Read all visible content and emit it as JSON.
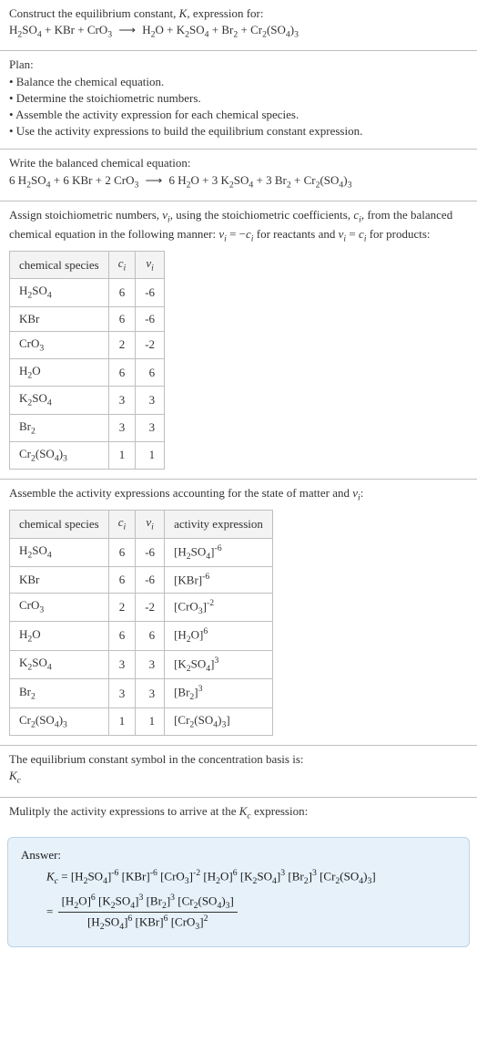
{
  "intro": {
    "line1_pre": "Construct the equilibrium constant, ",
    "line1_K": "K",
    "line1_post": ", expression for:"
  },
  "equation1": {
    "r1": "H",
    "r1s": "2",
    "r1b": "SO",
    "r1bs": "4",
    "plus1": " + ",
    "r2": "KBr",
    "plus2": " + ",
    "r3": "CrO",
    "r3s": "3",
    "arrow": "⟶",
    "p1": "H",
    "p1s": "2",
    "p1b": "O",
    "plus3": " + ",
    "p2": "K",
    "p2s": "2",
    "p2b": "SO",
    "p2bs": "4",
    "plus4": " + ",
    "p3": "Br",
    "p3s": "2",
    "plus5": " + ",
    "p4": "Cr",
    "p4s": "2",
    "p4b": "(SO",
    "p4bs": "4",
    "p4c": ")",
    "p4cs": "3"
  },
  "plan": {
    "title": "Plan:",
    "b1": "• Balance the chemical equation.",
    "b2": "• Determine the stoichiometric numbers.",
    "b3": "• Assemble the activity expression for each chemical species.",
    "b4": "• Use the activity expressions to build the equilibrium constant expression."
  },
  "balanced": {
    "title": "Write the balanced chemical equation:",
    "c1": "6 ",
    "c2": "6 ",
    "c3": "2 ",
    "c4": "6 ",
    "c5": "3 ",
    "c6": "3 "
  },
  "stoich": {
    "intro_a": "Assign stoichiometric numbers, ",
    "intro_b": ", using the stoichiometric coefficients, ",
    "intro_c": ", from the balanced chemical equation in the following manner: ",
    "intro_d": " for reactants and ",
    "intro_e": " for products:",
    "nu": "ν",
    "nui": "i",
    "c": "c",
    "ci": "i",
    "eq1a": "ν",
    "eq1b": " = −",
    "eq1c": "c",
    "eq2a": "ν",
    "eq2b": " = ",
    "eq2c": "c",
    "headers": {
      "h1": "chemical species",
      "h2": "c",
      "h2i": "i",
      "h3": "ν",
      "h3i": "i"
    },
    "rows": [
      {
        "sp": "H2SO4",
        "c": "6",
        "v": "-6"
      },
      {
        "sp": "KBr",
        "c": "6",
        "v": "-6"
      },
      {
        "sp": "CrO3",
        "c": "2",
        "v": "-2"
      },
      {
        "sp": "H2O",
        "c": "6",
        "v": "6"
      },
      {
        "sp": "K2SO4",
        "c": "3",
        "v": "3"
      },
      {
        "sp": "Br2",
        "c": "3",
        "v": "3"
      },
      {
        "sp": "Cr2(SO4)3",
        "c": "1",
        "v": "1"
      }
    ]
  },
  "activity": {
    "intro_a": "Assemble the activity expressions accounting for the state of matter and ",
    "intro_b": ":",
    "headers": {
      "h1": "chemical species",
      "h2": "c",
      "h2i": "i",
      "h3": "ν",
      "h3i": "i",
      "h4": "activity expression"
    },
    "rows": [
      {
        "c": "6",
        "v": "-6",
        "exp": "-6"
      },
      {
        "c": "6",
        "v": "-6",
        "exp": "-6"
      },
      {
        "c": "2",
        "v": "-2",
        "exp": "-2"
      },
      {
        "c": "6",
        "v": "6",
        "exp": "6"
      },
      {
        "c": "3",
        "v": "3",
        "exp": "3"
      },
      {
        "c": "3",
        "v": "3",
        "exp": "3"
      },
      {
        "c": "1",
        "v": "1",
        "exp": ""
      }
    ]
  },
  "kcSymbol": {
    "line1": "The equilibrium constant symbol in the concentration basis is:",
    "K": "K",
    "c": "c"
  },
  "multiply": {
    "line_a": "Mulitply the activity expressions to arrive at the ",
    "line_b": " expression:"
  },
  "answer": {
    "label": "Answer:",
    "eq": " = ",
    "exp": {
      "e1": "-6",
      "e2": "-6",
      "e3": "-2",
      "e4": "6",
      "e5": "3",
      "e6": "3",
      "d1": "6",
      "d2": "6",
      "d3": "2"
    }
  }
}
